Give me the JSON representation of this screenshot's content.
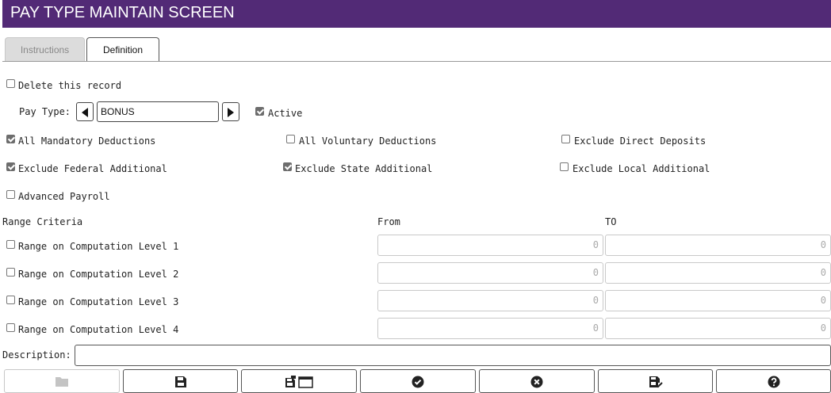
{
  "header": {
    "title": "PAY TYPE MAINTAIN SCREEN"
  },
  "tabs": [
    {
      "label": "Instructions",
      "active": false
    },
    {
      "label": "Definition",
      "active": true
    }
  ],
  "form": {
    "delete_record": {
      "label": "Delete this record",
      "checked": false
    },
    "pay_type": {
      "label": "Pay Type:",
      "value": "BONUS"
    },
    "active": {
      "label": "Active",
      "checked": true
    },
    "options": [
      {
        "label": "All Mandatory Deductions",
        "checked": true
      },
      {
        "label": "All Voluntary Deductions",
        "checked": false
      },
      {
        "label": "Exclude Direct Deposits",
        "checked": false
      },
      {
        "label": "Exclude Federal Additional",
        "checked": true
      },
      {
        "label": "Exclude State Additional",
        "checked": true
      },
      {
        "label": "Exclude Local Additional",
        "checked": false
      },
      {
        "label": "Advanced Payroll",
        "checked": false
      }
    ],
    "range": {
      "title": "Range Criteria",
      "from_label": "From",
      "to_label": "TO",
      "rows": [
        {
          "label": "Range on Computation Level 1",
          "checked": false,
          "from": "0",
          "to": "0"
        },
        {
          "label": "Range on Computation Level 2",
          "checked": false,
          "from": "0",
          "to": "0"
        },
        {
          "label": "Range on Computation Level 3",
          "checked": false,
          "from": "0",
          "to": "0"
        },
        {
          "label": "Range on Computation Level 4",
          "checked": false,
          "from": "0",
          "to": "0"
        }
      ]
    },
    "description": {
      "label": "Description:",
      "value": ""
    }
  },
  "toolbar": [
    {
      "icon": "folder-icon",
      "enabled": false
    },
    {
      "icon": "save-icon",
      "enabled": true
    },
    {
      "icon": "save-window-icon",
      "enabled": true
    },
    {
      "icon": "check-circle-icon",
      "enabled": true
    },
    {
      "icon": "close-circle-icon",
      "enabled": true
    },
    {
      "icon": "save-check-icon",
      "enabled": true
    },
    {
      "icon": "help-icon",
      "enabled": true
    }
  ],
  "colors": {
    "header_bg": "#522a76",
    "header_text": "#ffffff"
  }
}
